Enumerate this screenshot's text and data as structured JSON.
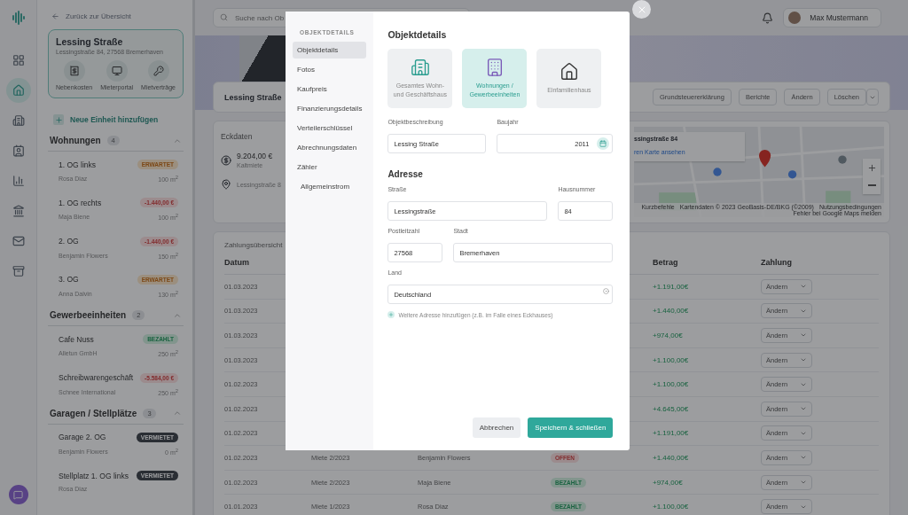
{
  "rail": {
    "items": [
      {
        "selected": false
      },
      {
        "selected": true
      },
      {
        "selected": false
      },
      {
        "selected": false
      },
      {
        "selected": false
      },
      {
        "selected": false
      },
      {
        "selected": false
      },
      {
        "selected": false
      }
    ]
  },
  "sidebar": {
    "back": "Zurück zur Übersicht",
    "property": {
      "name": "Lessing Straße",
      "address": "Lessingstraße 84, 27568 Bremerhaven",
      "actions": [
        "Nebenkosten",
        "Mieterportal",
        "Mietverträge"
      ]
    },
    "add_unit": "Neue Einheit hinzufügen",
    "groups": [
      {
        "title": "Wohnungen",
        "count": "4",
        "expanded": true,
        "units": [
          {
            "name": "1. OG links",
            "tenant": "Rosa Diaz",
            "area": "100 m$^{2}$",
            "status": {
              "kind": "erwartet",
              "text": "ERWARTET"
            }
          },
          {
            "name": "1. OG rechts",
            "tenant": "Maja Biene",
            "area": "100 m$^{2}$",
            "status": {
              "kind": "negative",
              "text": "-1.440,00 €"
            }
          },
          {
            "name": "2. OG",
            "tenant": "Benjamin Flowers",
            "area": "150 m$^{2}$",
            "status": {
              "kind": "negative",
              "text": "-1.440,00 €"
            }
          },
          {
            "name": "3. OG",
            "tenant": "Anna Dalvin",
            "area": "130 m$^{2}$",
            "status": {
              "kind": "erwartet",
              "text": "ERWARTET"
            }
          }
        ]
      },
      {
        "title": "Gewerbeeinheiten",
        "count": "2",
        "expanded": true,
        "units": [
          {
            "name": "Cafe Nuss",
            "tenant": "Alletun GmbH",
            "area": "250 m$^{2}$",
            "status": {
              "kind": "bezahlt",
              "text": "BEZAHLT"
            }
          },
          {
            "name": "Schreibwarengeschäft",
            "tenant": "Schnee International",
            "area": "250 m$^{2}$",
            "status": {
              "kind": "negative",
              "text": "-5.584,00 €"
            }
          }
        ]
      },
      {
        "title": "Garagen / Stellplätze",
        "count": "3",
        "expanded": true,
        "units": [
          {
            "name": "Garage 2. OG",
            "tenant": "Benjamin Flowers",
            "area": "0 m$^{2}$",
            "status": {
              "kind": "vermietet",
              "text": "VERMIETET"
            }
          },
          {
            "name": "Stellplatz 1. OG links",
            "tenant": "Rosa Diaz",
            "status": {
              "kind": "vermietet",
              "text": "VERMIETET"
            }
          }
        ]
      }
    ]
  },
  "topbar": {
    "search_placeholder": "Suche nach Ob",
    "user": "Max Mustermann"
  },
  "header": {
    "title": "Lessing Straße",
    "buttons": [
      "Grundsteuererklärung",
      "Berichte",
      "Ändern",
      "Löschen"
    ]
  },
  "key_data": {
    "title": "Eckdaten",
    "amount": "9.204,00 €",
    "amount_label": "Kaltmiete",
    "address": "Lessingstraße 8",
    "map": {
      "info_title": "ssingstraße 84",
      "info_link": "ren Karte ansehen",
      "attribution": [
        "Kurzbefehle",
        "Kartendaten © 2023 GeoBasis-DE/BKG (©2009)",
        "Nutzungsbedingungen",
        "Fehler bei Google Maps melden"
      ]
    }
  },
  "payments": {
    "title": "Zahlungsübersicht",
    "columns": [
      "Datum",
      "Betrag",
      "Zahlung"
    ],
    "rows": [
      {
        "date": "01.03.2023",
        "amount": "+1.191,00€",
        "action": "Ändern"
      },
      {
        "date": "01.03.2023",
        "amount": "+1.440,00€",
        "action": "Ändern"
      },
      {
        "date": "01.03.2023",
        "amount": "+974,00€",
        "action": "Ändern"
      },
      {
        "date": "01.03.2023",
        "amount": "+1.100,00€",
        "action": "Ändern"
      },
      {
        "date": "01.02.2023",
        "amount": "+1.100,00€",
        "action": "Ändern"
      },
      {
        "date": "01.02.2023",
        "amount": "+4.645,00€",
        "action": "Ändern"
      },
      {
        "date": "01.02.2023",
        "amount": "+1.191,00€",
        "action": "Ändern"
      },
      {
        "date": "01.02.2023",
        "purpose": "Miete 2/2023",
        "tenant": "Benjamin Flowers",
        "status": {
          "kind": "offen",
          "text": "OFFEN"
        },
        "amount": "+1.440,00€",
        "action": "Ändern"
      },
      {
        "date": "01.02.2023",
        "purpose": "Miete 2/2023",
        "tenant": "Maja Biene",
        "status": {
          "kind": "bezahlt",
          "text": "BEZAHLT"
        },
        "amount": "+974,00€",
        "action": "Ändern"
      },
      {
        "date": "01.01.2023",
        "purpose": "Miete 1/2023",
        "tenant": "Rosa Diaz",
        "status": {
          "kind": "bezahlt",
          "text": "BEZAHLT"
        },
        "amount": "+1.100,00€",
        "action": "Ändern"
      }
    ]
  },
  "modal": {
    "nav_heading": "OBJEKTDETAILS",
    "nav": [
      {
        "label": "Objektdetails",
        "selected": true
      },
      {
        "label": "Fotos",
        "selected": false
      },
      {
        "label": "Kaufpreis",
        "selected": false
      },
      {
        "label": "Finanzierungsdetails",
        "selected": false
      },
      {
        "label": "Verteilerschlüssel",
        "selected": false
      },
      {
        "label": "Abrechnungsdaten",
        "selected": false
      },
      {
        "label": "Zähler",
        "selected": false,
        "children": [
          {
            "label": "Allgemeinstrom",
            "selected": false
          }
        ]
      }
    ],
    "title": "Objektdetails",
    "types": [
      {
        "label": "Gesamtes Wohn- und Geschäftshaus",
        "selected": false
      },
      {
        "label": "Wohnungen / Gewerbeeinheiten",
        "selected": true
      },
      {
        "label": "Einfamilienhaus",
        "selected": false
      }
    ],
    "description": {
      "label": "Objektbeschreibung",
      "value": "Lessing Straße"
    },
    "year": {
      "label": "Baujahr",
      "value": "2011"
    },
    "address_title": "Adresse",
    "street": {
      "label": "Straße",
      "value": "Lessingstraße"
    },
    "house_number": {
      "label": "Hausnummer",
      "value": "84"
    },
    "postal_code": {
      "label": "Postleitzahl",
      "value": "27568"
    },
    "city": {
      "label": "Stadt",
      "value": "Bremerhaven"
    },
    "country": {
      "label": "Land",
      "value": "Deutschland"
    },
    "add_link": "Weitere Adresse hinzufügen (z.B. im Falle eines Eckhauses)",
    "buttons": [
      "Abbrechen",
      "Speichern & schließen"
    ]
  }
}
